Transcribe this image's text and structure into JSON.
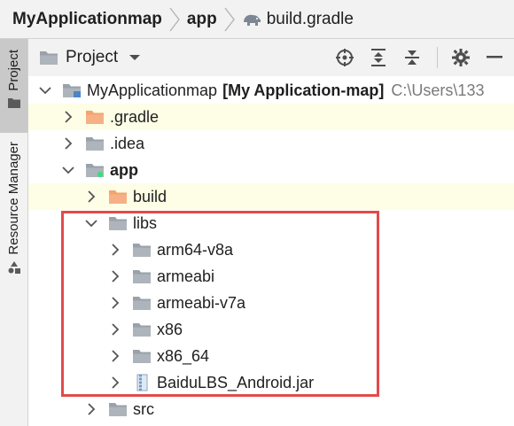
{
  "breadcrumb": {
    "items": [
      {
        "label": "MyApplicationmap"
      },
      {
        "label": "app"
      },
      {
        "label": "build.gradle"
      }
    ]
  },
  "toolstrip": {
    "project_label": "Project",
    "resource_manager_label": "Resource Manager"
  },
  "tool_window": {
    "title": "Project"
  },
  "tree": {
    "root": {
      "name": "MyApplicationmap",
      "module": "[My Application-map]",
      "path": "C:\\Users\\133"
    },
    "gradle": ".gradle",
    "idea": ".idea",
    "app": "app",
    "build": "build",
    "libs": "libs",
    "arm64": "arm64-v8a",
    "armeabi": "armeabi",
    "armeabi_v7a": "armeabi-v7a",
    "x86": "x86",
    "x86_64": "x86_64",
    "jar": "BaiduLBS_Android.jar",
    "src": "src"
  },
  "colors": {
    "highlight": "#fefde6",
    "folder_gray": "#9aa1a9",
    "folder_orange": "#f3a470",
    "annotation_red": "#e24b4b"
  }
}
